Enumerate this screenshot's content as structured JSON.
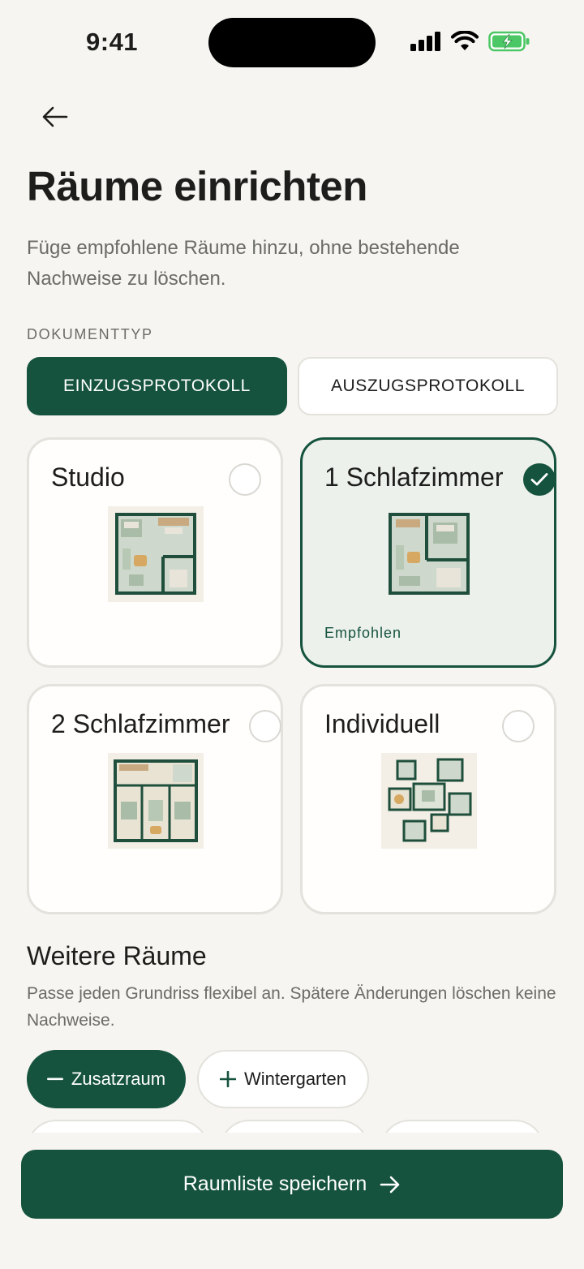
{
  "status": {
    "time": "9:41"
  },
  "header": {
    "title": "Räume einrichten",
    "subtitle": "Füge empfohlene Räume hinzu, ohne bestehende Nachweise zu löschen."
  },
  "document_type": {
    "label": "DOKUMENTTYP",
    "options": [
      "EINZUGSPROTOKOLL",
      "AUSZUGSPROTOKOLL"
    ],
    "selected": "EINZUGSPROTOKOLL"
  },
  "layouts": [
    {
      "title": "Studio",
      "selected": false,
      "icon": "studio-floorplan"
    },
    {
      "title": "1 Schlafzimmer",
      "selected": true,
      "badge": "Empfohlen",
      "icon": "one-bedroom-floorplan"
    },
    {
      "title": "2 Schlafzimmer",
      "selected": false,
      "icon": "two-bedroom-floorplan"
    },
    {
      "title": "Individuell",
      "selected": false,
      "icon": "custom-floorplan"
    }
  ],
  "more_rooms": {
    "title": "Weitere Räume",
    "description": "Passe jeden Grundriss flexibel an. Spätere Änderungen löschen keine Nachweise.",
    "chips": [
      {
        "label": "Zusatzraum",
        "active": true,
        "icon": "minus-icon"
      },
      {
        "label": "Wintergarten",
        "active": false,
        "icon": "plus-icon"
      }
    ]
  },
  "cta": {
    "label": "Raumliste speichern"
  },
  "colors": {
    "accent": "#15533f",
    "background": "#f6f5f1",
    "selected_card": "#edf1ec"
  }
}
